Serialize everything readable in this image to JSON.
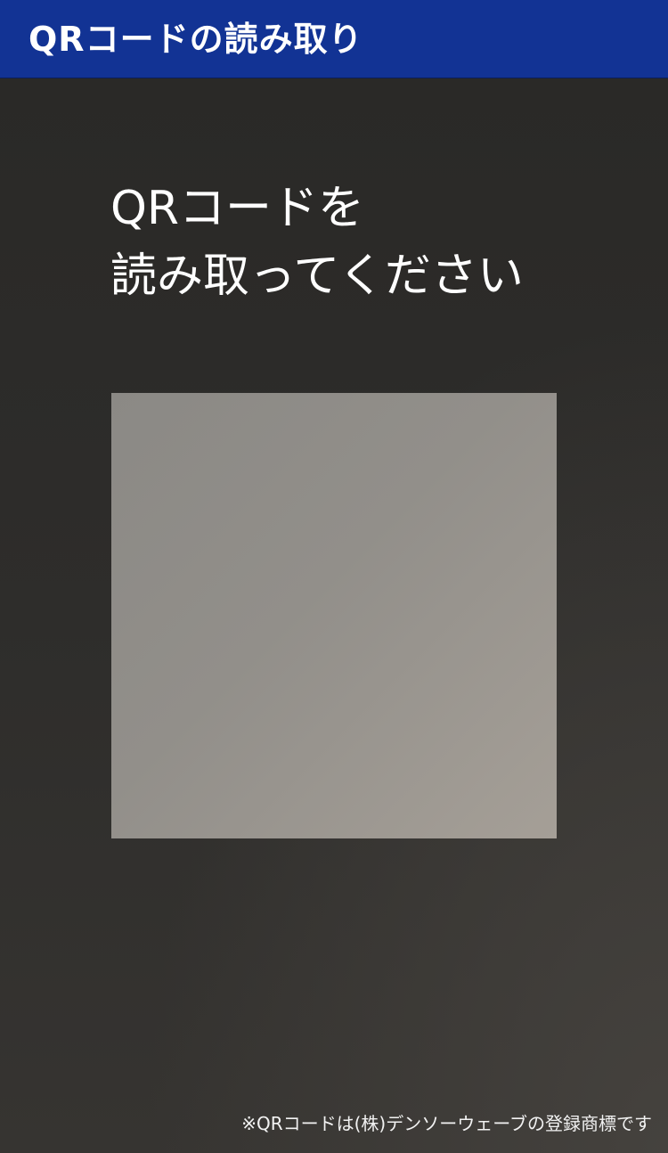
{
  "header": {
    "title": "QRコードの読み取り"
  },
  "scanner": {
    "instruction_line1": "QRコードを",
    "instruction_line2": "読み取ってください"
  },
  "footer": {
    "trademark_note": "※QRコードは(株)デンソーウェーブの登録商標です"
  },
  "colors": {
    "header_bg": "#123394",
    "camera_bg": "#2b2a28",
    "frame_fill": "#928f8a"
  }
}
